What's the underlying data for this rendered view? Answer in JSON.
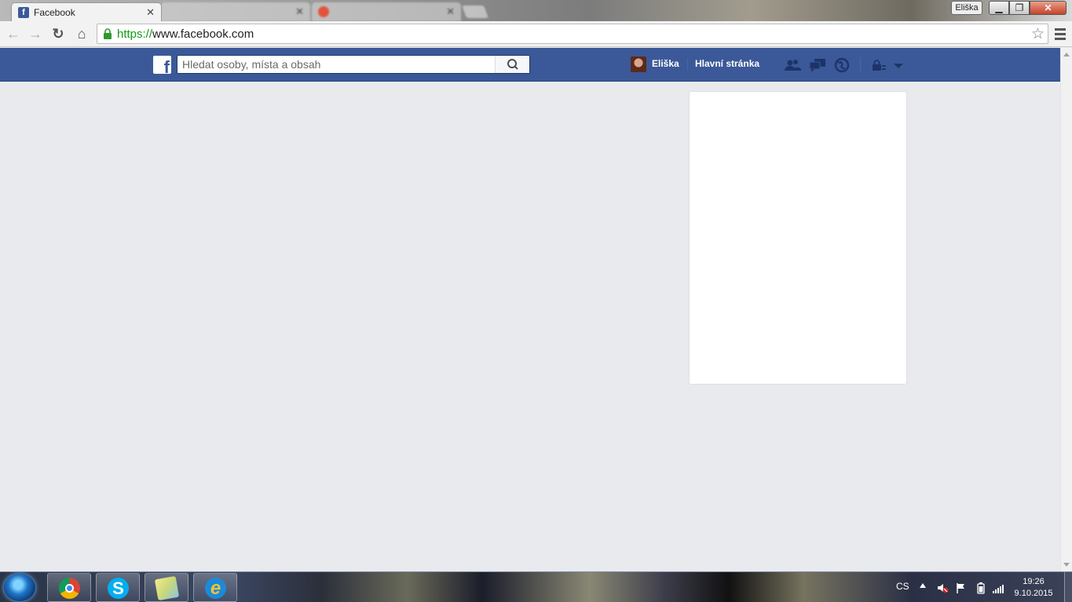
{
  "browser": {
    "tabs": [
      {
        "title": "Facebook",
        "active": true
      },
      {
        "title": "",
        "active": false
      },
      {
        "title": "",
        "active": false
      }
    ],
    "profile_name": "Eliška",
    "url_protocol": "https://",
    "url_rest": "www.facebook.com"
  },
  "facebook": {
    "search_placeholder": "Hledat osoby, místa a obsah",
    "user_name": "Eliška",
    "home_label": "Hlavní stránka",
    "brand_color": "#3b5998"
  },
  "taskbar": {
    "language": "CS",
    "time": "19:26",
    "date": "9.10.2015",
    "pinned": [
      "chrome-icon",
      "skype-icon",
      "sticky-notes-icon",
      "internet-explorer-icon"
    ]
  }
}
